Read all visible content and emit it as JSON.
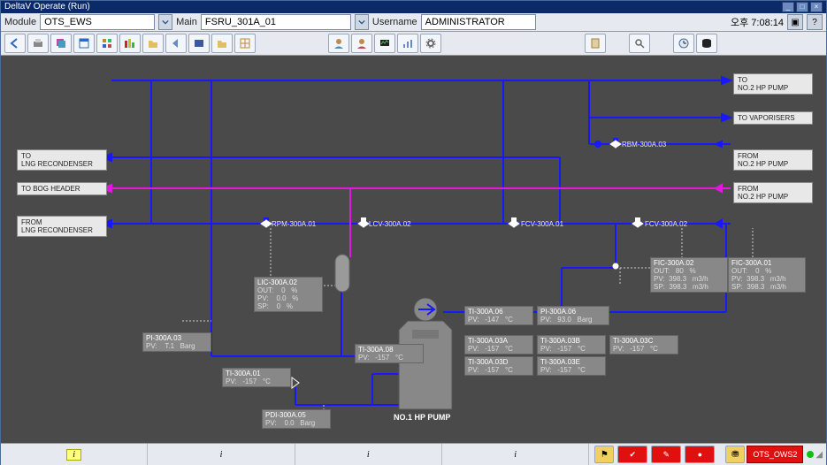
{
  "window": {
    "title": "DeltaV Operate (Run)"
  },
  "header": {
    "module_label": "Module",
    "module_value": "OTS_EWS",
    "main_label": "Main",
    "main_value": "FSRU_301A_01",
    "username_label": "Username",
    "username_value": "ADMINISTRATOR",
    "clock": "오후 7:08:14"
  },
  "labels": {
    "to_hp2": "TO\nNO.2 HP PUMP",
    "to_vap": "TO VAPORISERS",
    "from_hp2_a": "FROM\nNO.2 HP PUMP",
    "from_hp2_b": "FROM\nNO.2 HP PUMP",
    "to_recond": "TO\nLNG RECONDENSER",
    "to_bog": "TO BOG HEADER",
    "from_recond": "FROM\nLNG RECONDENSER",
    "equip": "NO.1 HP PUMP"
  },
  "valves": {
    "rpm300a01": "RPM-300A.01",
    "lcv300a02": "LCV-300A.02",
    "fcv300a01": "FCV-300A.01",
    "fcv300a02": "FCV-300A.02",
    "rbm300a03": "RBM-300A.03"
  },
  "tags": {
    "lic300a02": {
      "name": "LIC-300A.02",
      "l1": "OUT:    0   %",
      "l2": "PV:    0.0   %",
      "l3": "SP:    0   %"
    },
    "pi300a03": {
      "name": "PI-300A.03",
      "l1": "PV:    T.1   Barg"
    },
    "ti300a01": {
      "name": "TI-300A.01",
      "l1": "PV:   -157   °C"
    },
    "ti300a08": {
      "name": "TI-300A.08",
      "l1": "PV:   -157   °C"
    },
    "pdi300a05": {
      "name": "PDI-300A.05",
      "l1": "PV:    0.0   Barg"
    },
    "ti300a06": {
      "name": "TI-300A.06",
      "l1": "PV:   -147   °C"
    },
    "pi300a06": {
      "name": "PI-300A.06",
      "l1": "PV:   93.0   Barg"
    },
    "ti300a03a": {
      "name": "TI-300A.03A",
      "l1": "PV:   -157   °C"
    },
    "ti300a03b": {
      "name": "TI-300A.03B",
      "l1": "PV:   -157   °C"
    },
    "ti300a03c": {
      "name": "TI-300A.03C",
      "l1": "PV:   -157   °C"
    },
    "ti300a03d": {
      "name": "TI-300A.03D",
      "l1": "PV:   -157   °C"
    },
    "ti300a03e": {
      "name": "TI-300A.03E",
      "l1": "PV:   -157   °C"
    },
    "fic300a02": {
      "name": "FIC-300A.02",
      "l1": "OUT:   80   %",
      "l2": "PV:  398.3   m3/h",
      "l3": "SP:  398.3   m3/h"
    },
    "fic300a01": {
      "name": "FIC-300A.01",
      "l1": "OUT:    0   %",
      "l2": "PV:  398.3   m3/h",
      "l3": "SP:  398.3   m3/h"
    }
  },
  "footer": {
    "info": "i",
    "station": "OTS_OWS2"
  }
}
